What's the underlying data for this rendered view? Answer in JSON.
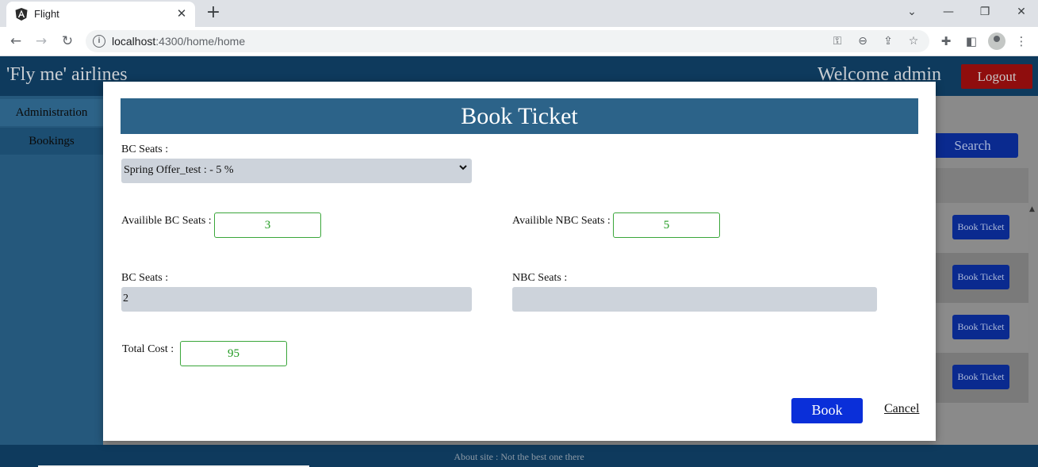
{
  "browser": {
    "tab_title": "Flight",
    "url_host": "localhost",
    "url_path": ":4300/home/home",
    "tab_close": "✕",
    "new_tab": "+"
  },
  "app": {
    "brand": "'Fly me' airlines",
    "welcome": "Welcome admin",
    "logout_label": "Logout",
    "sidebar": {
      "items": [
        {
          "label": "Administration"
        },
        {
          "label": "Bookings"
        }
      ]
    },
    "search_label": "Search",
    "book_ticket_buttons": [
      "Book Ticket",
      "Book Ticket",
      "Book Ticket",
      "Book Ticket"
    ],
    "footer": "About site : Not the best one there"
  },
  "modal": {
    "title": "Book Ticket",
    "offer_label": "BC Seats :",
    "offer_selected": "Spring Offer_test : - 5 %",
    "available_bc_label": "Availible BC Seats :",
    "available_bc_value": "3",
    "available_nbc_label": "Availible NBC Seats :",
    "available_nbc_value": "5",
    "bc_seats_label": "BC Seats :",
    "bc_seats_value": "2",
    "nbc_seats_label": "NBC Seats :",
    "nbc_seats_value": "",
    "total_cost_label": "Total Cost :",
    "total_cost_value": "95",
    "book_label": "Book",
    "cancel_label": "Cancel"
  },
  "colors": {
    "header": "#0e3a5d",
    "modal_title_bg": "#2c6389",
    "logout_bg": "#8f0d0d",
    "book_btn": "#0a2fd9",
    "value_green": "#1f9a1f"
  }
}
